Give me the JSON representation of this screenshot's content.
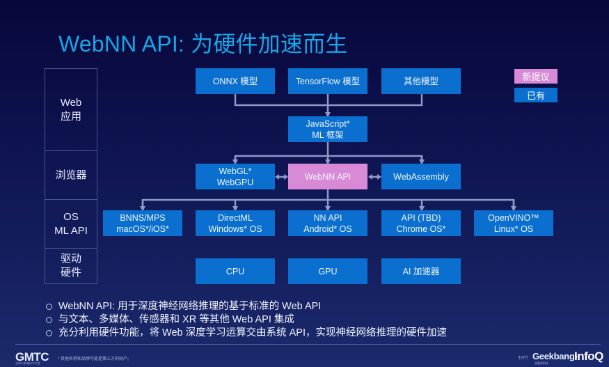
{
  "slide": {
    "title": "WebNN API: 为硬件加速而生"
  },
  "layers": [
    {
      "label": "Web\n应用"
    },
    {
      "label": "浏览器"
    },
    {
      "label": "OS\nML API"
    },
    {
      "label": "驱动\n硬件"
    }
  ],
  "legend": {
    "new_proposal": "新提议",
    "existing": "已有",
    "new_color": "#d98ad6",
    "existing_color": "#0a6fce"
  },
  "diagram": {
    "models": [
      "ONNX 模型",
      "TensorFlow 模型",
      "其他模型"
    ],
    "framework": "JavaScript*\nML 框架",
    "browser": {
      "webgl": "WebGL*\nWebGPU",
      "webnn": "WebNN API",
      "wasm": "WebAssembly"
    },
    "os_apis": [
      "BNNS/MPS\nmacOS*/iOS*",
      "DirectML\nWindows* OS",
      "NN API\nAndroid* OS",
      "API (TBD)\nChrome OS*",
      "OpenVINO™\nLinux* OS"
    ],
    "hardware": [
      "CPU",
      "GPU",
      "AI 加速器"
    ]
  },
  "bullets": [
    "WebNN API: 用于深度神经网络推理的基于标准的 Web API",
    "与文本、多媒体、传感器和 XR 等其他 Web API 集成",
    "充分利用硬件功能，将 Web 深度学习运算交由系统 API，实现神经网络推理的硬件加速"
  ],
  "footer": {
    "logo": "GMTC",
    "logo_sub": "全球大前端技术大会",
    "disclaimer": "* 其他名称和品牌可能是第三方的财产。",
    "sponsor_label": "主办方",
    "geekbang": "Geekbang›",
    "geekbang_sub": "极客邦科技",
    "infoq": "InfoQ"
  }
}
